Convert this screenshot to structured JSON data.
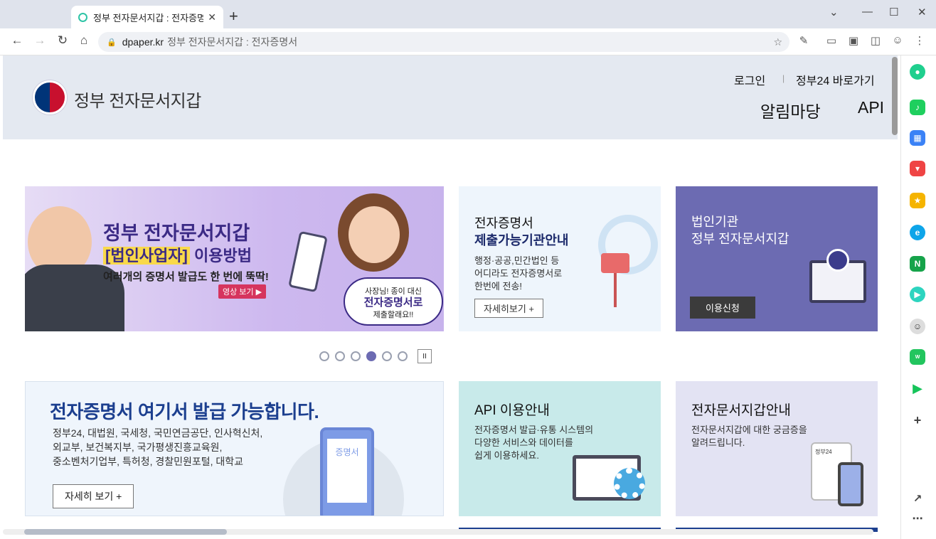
{
  "browser": {
    "tab_title": "정부 전자문서지갑 : 전자증명",
    "tab_close": "✕",
    "new_tab": "+",
    "url_domain": "dpaper.kr",
    "url_rest": "정부 전자문서지갑 : 전자증명서",
    "min": "⌄",
    "minimize": "—",
    "maximize": "☐",
    "close": "✕"
  },
  "header": {
    "site_name": "정부 전자문서지갑",
    "login": "로그인",
    "gov24_link": "정부24 바로가기",
    "nav": [
      "알림마당",
      "API"
    ]
  },
  "banners": [
    {
      "title": "정부 전자문서지갑",
      "subtitle_highlight": "[법인사업자]",
      "subtitle_rest": "이용방법",
      "desc": "여러개의 증명서 발급도 한 번에 뚝딱!",
      "button": "영상 보기 ▶",
      "bubble_line1": "사장님! 종이 대신",
      "bubble_line2": "전자증명서로",
      "bubble_line3": "제출할래요!!"
    },
    {
      "title_line1": "전자증명서",
      "title_line2": "제출가능기관안내",
      "desc_line1": "행정·공공,민간법인 등",
      "desc_line2": "어디라도 전자증명서로",
      "desc_line3": "한번에 전송!",
      "button": "자세히보기 +"
    },
    {
      "title_line1": "법인기관",
      "title_line2": "정부 전자문서지갑",
      "button": "이용신청"
    }
  ],
  "slider": {
    "count": 6,
    "active_index": 3,
    "pause_label": "II"
  },
  "cards": [
    {
      "title": "전자증명서 여기서 발급 가능합니다.",
      "line1": "정부24, 대법원, 국세청, 국민연금공단, 인사혁신처,",
      "line2": "외교부, 보건복지부, 국가평생진흥교육원,",
      "line3": "중소벤처기업부, 특허청, 경찰민원포털, 대학교",
      "button": "자세히 보기 +",
      "doc_label": "증명서"
    },
    {
      "title": "API 이용안내",
      "line1": "전자증명서 발급·유통 시스템의",
      "line2": "다양한 서비스와 데이터를",
      "line3": "쉽게 이용하세요."
    },
    {
      "title": "전자문서지갑안내",
      "line1": "전자문서지갑에 대한 궁금증을",
      "line2": "알려드립니다.",
      "phone_label": "정부24"
    }
  ],
  "colors": {
    "accent": "#6c6bb2",
    "header_bg": "#e4e9f1",
    "title_blue": "#1c3f8f"
  }
}
